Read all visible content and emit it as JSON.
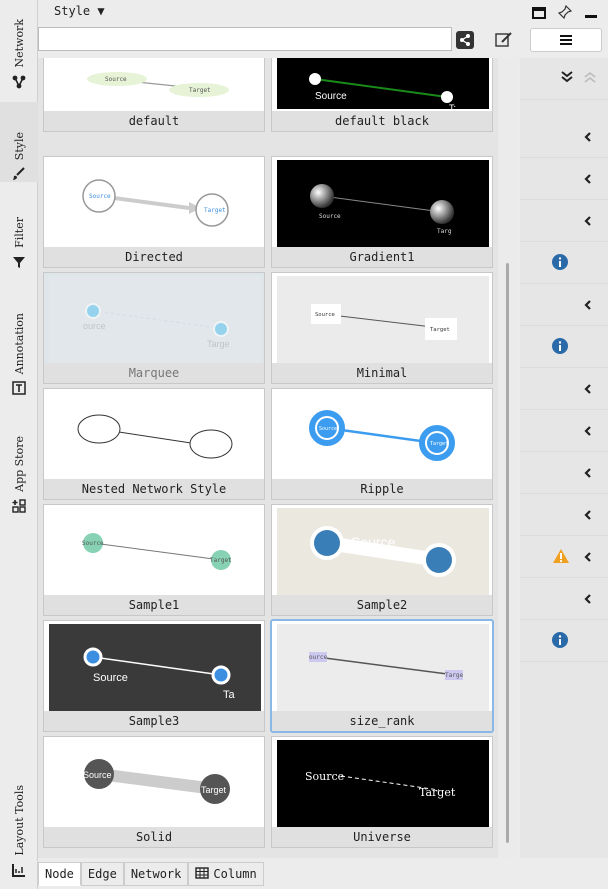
{
  "left_tabs": [
    {
      "label": "Network",
      "icon": "network-icon"
    },
    {
      "label": "Style",
      "icon": "brush-icon",
      "active": true
    },
    {
      "label": "Filter",
      "icon": "filter-icon"
    },
    {
      "label": "Annotation",
      "icon": "annotation-icon"
    },
    {
      "label": "App Store",
      "icon": "app-store-icon"
    },
    {
      "label": "Layout Tools",
      "icon": "layout-tools-icon"
    }
  ],
  "header": {
    "style_menu": "Style ▼"
  },
  "search": {
    "value": "",
    "placeholder": ""
  },
  "styles": [
    {
      "name": "default"
    },
    {
      "name": "default black"
    },
    {
      "name": "Directed"
    },
    {
      "name": "Gradient1"
    },
    {
      "name": "Marquee"
    },
    {
      "name": "Minimal"
    },
    {
      "name": "Nested Network Style"
    },
    {
      "name": "Ripple"
    },
    {
      "name": "Sample1"
    },
    {
      "name": "Sample2"
    },
    {
      "name": "Sample3"
    },
    {
      "name": "size_rank"
    },
    {
      "name": "Solid"
    },
    {
      "name": "Universe"
    }
  ],
  "preview_text": {
    "source": "Source",
    "target": "Target",
    "src_short": "Source",
    "tgt_short": "Targ",
    "marquee_src": "ource",
    "marquee_tgt": "Targe",
    "black_tgt": "T:",
    "s3_tgt": "Ta",
    "size_src": "ource",
    "size_tgt": "Targe",
    "universe_src": "Source",
    "universe_tgt": "Target",
    "minimal_src": "Source",
    "minimal_tgt": "Target",
    "solid_src": "Source",
    "solid_tgt": "Target"
  },
  "gutter_icons": [
    "collapse-icon",
    "chevron-left-icon",
    "chevron-left-icon",
    "chevron-left-icon",
    "info-icon",
    "chevron-left-icon",
    "info-icon",
    "chevron-left-icon",
    "chevron-left-icon",
    "chevron-left-icon",
    "chevron-left-icon",
    "warning-icon",
    "chevron-left-icon",
    "info-icon"
  ],
  "bottom_tabs": [
    {
      "label": "Node",
      "active": true
    },
    {
      "label": "Edge"
    },
    {
      "label": "Network"
    },
    {
      "label": "Column",
      "icon": "table-icon"
    }
  ],
  "colors": {
    "accent": "#3c8fe0",
    "info": "#2b6aa8",
    "warning": "#f0a020",
    "selected_border": "#8ab8e6"
  }
}
